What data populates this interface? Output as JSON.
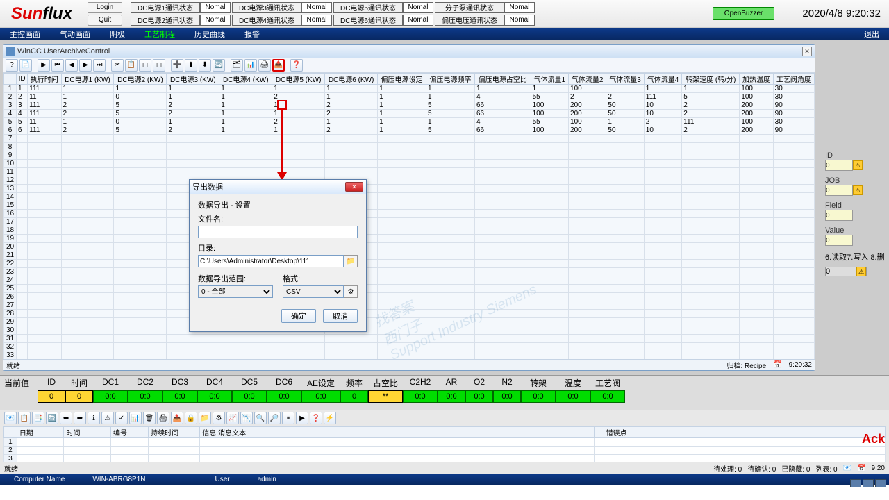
{
  "logo": {
    "a": "Sun",
    "b": "flux"
  },
  "auth": {
    "login": "Login",
    "quit": "Quit"
  },
  "dc_status": [
    {
      "label": "DC电源1通讯状态",
      "val": "Nomal"
    },
    {
      "label": "DC电源3通讯状态",
      "val": "Nomal"
    },
    {
      "label": "DC电源5通讯状态",
      "val": "Nomal"
    },
    {
      "label": "分子泵通讯状态",
      "val": "Nomal"
    },
    {
      "label": "DC电源2通讯状态",
      "val": "Nomal"
    },
    {
      "label": "DC电源4通讯状态",
      "val": "Nomal"
    },
    {
      "label": "DC电源6通讯状态",
      "val": "Nomal"
    },
    {
      "label": "偏压电压通讯状态",
      "val": "Nomal"
    }
  ],
  "openbuzzer": "OpenBuzzer",
  "datetime": "2020/4/8 9:20:32",
  "nav": {
    "tabs": [
      "主控画面",
      "气动画面",
      "阴极",
      "工艺制程",
      "历史曲线",
      "报警"
    ],
    "active": 3,
    "exit": "退出"
  },
  "archive": {
    "title": "WinCC UserArchiveControl",
    "icons": [
      "?",
      "📄",
      "▶",
      "⏮",
      "◀",
      "▶",
      "⏭",
      "✂",
      "📋",
      "◻",
      "◻",
      "➕",
      "⬆",
      "⬇",
      "🔄",
      "🗂",
      "📊",
      "🖨",
      "📤",
      "❓"
    ],
    "headers": [
      "ID",
      "执行时间",
      "DC电源1 (KW)",
      "DC电源2 (KW)",
      "DC电源3 (KW)",
      "DC电源4 (KW)",
      "DC电源5 (KW)",
      "DC电源6 (KW)",
      "偏压电源设定",
      "偏压电源频率",
      "偏压电源占空比",
      "气体流量1",
      "气体流量2",
      "气体流量3",
      "气体流量4",
      "转架速度 (转/分)",
      "加热温度",
      "工艺阀角度"
    ],
    "rows": [
      [
        "1",
        "111",
        "1",
        "1",
        "1",
        "1",
        "1",
        "1",
        "1",
        "1",
        "1",
        "1",
        "100",
        "",
        "1",
        "1",
        "100",
        "30"
      ],
      [
        "2",
        "11",
        "1",
        "0",
        "1",
        "1",
        "2",
        "1",
        "1",
        "1",
        "4",
        "55",
        "2",
        "2",
        "111",
        "5",
        "100",
        "30"
      ],
      [
        "3",
        "111",
        "2",
        "5",
        "2",
        "1",
        "1",
        "2",
        "1",
        "5",
        "66",
        "100",
        "200",
        "50",
        "10",
        "2",
        "200",
        "90"
      ],
      [
        "4",
        "111",
        "2",
        "5",
        "2",
        "1",
        "1",
        "2",
        "1",
        "5",
        "66",
        "100",
        "200",
        "50",
        "10",
        "2",
        "200",
        "90"
      ],
      [
        "5",
        "11",
        "1",
        "0",
        "1",
        "1",
        "2",
        "1",
        "1",
        "1",
        "4",
        "55",
        "100",
        "1",
        "2",
        "111",
        "100",
        "30"
      ],
      [
        "6",
        "111",
        "2",
        "5",
        "2",
        "1",
        "1",
        "2",
        "1",
        "5",
        "66",
        "100",
        "200",
        "50",
        "10",
        "2",
        "200",
        "90"
      ]
    ],
    "status_left": "就绪",
    "status_recipe": "归档: Recipe",
    "status_time": "9:20:32"
  },
  "side": {
    "id": {
      "label": "ID",
      "val": "0"
    },
    "job": {
      "label": "JOB",
      "val": "0"
    },
    "field": {
      "label": "Field",
      "val": "0"
    },
    "value": {
      "label": "Value",
      "val": "0"
    },
    "rw": "6.读取7.写入 8.删",
    "bar": "0"
  },
  "dlg": {
    "title": "导出数据",
    "subtitle": "数据导出 - 设置",
    "filename_lbl": "文件名:",
    "filename": "",
    "dir_lbl": "目录:",
    "dir": "C:\\Users\\Administrator\\Desktop\\111",
    "range_lbl": "数据导出范围:",
    "range": "0 - 全部",
    "fmt_lbl": "格式:",
    "fmt": "CSV",
    "ok": "确定",
    "cancel": "取消"
  },
  "readout": {
    "group": "当前值",
    "hdr": [
      "ID",
      "时间",
      "DC1",
      "DC2",
      "DC3",
      "DC4",
      "DC5",
      "DC6",
      "AE设定",
      "频率",
      "占空比",
      "C2H2",
      "AR",
      "O2",
      "N2",
      "转架",
      "温度",
      "工艺阀"
    ],
    "vals": [
      "0",
      "0",
      "0:0",
      "0:0",
      "0:0",
      "0:0",
      "0:0",
      "0:0",
      "0:0",
      "0",
      "**",
      "0:0",
      "0:0",
      "0:0",
      "0:0",
      "0:0",
      "0:0",
      "0:0"
    ]
  },
  "alarm": {
    "headers": [
      "日期",
      "时间",
      "编号",
      "持续时间",
      "信息 消息文本",
      "",
      "错误点"
    ],
    "status_left": "就绪",
    "pending": "待处理: 0",
    "ack": "待确认: 0",
    "hidden": "已隐藏: 0",
    "list": "列表: 0",
    "time": "9:20"
  },
  "ack_label": "Ack",
  "footer": {
    "cn_lbl": "Computer Name",
    "cn": "WIN-ABRG8P1N",
    "user_lbl": "User",
    "user": "admin"
  }
}
